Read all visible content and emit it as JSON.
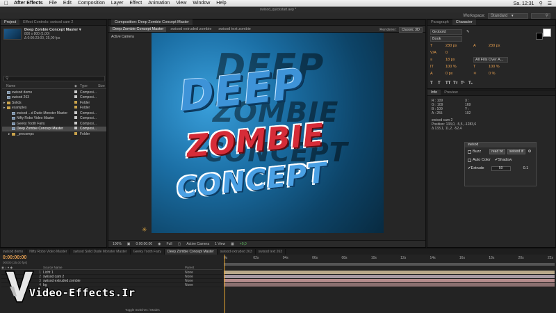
{
  "menubar": {
    "app_name": "After Effects",
    "items": [
      "File",
      "Edit",
      "Composition",
      "Layer",
      "Effect",
      "Animation",
      "View",
      "Window",
      "Help"
    ],
    "clock": "Sa. 12:31"
  },
  "window": {
    "title": "swisod_quickstart.aep *"
  },
  "workspace": {
    "label": "Workspace:",
    "value": "Standard"
  },
  "project_panel": {
    "tabs": [
      "Project",
      "Effect Controls: swisod cam 2"
    ],
    "selected_name": "Deep Zombie Concept Master ▾",
    "selected_size": "800 x 800 (1,00)",
    "selected_duration": "Δ 0:00:23:00, 25,00 fps",
    "columns": {
      "name": "Name",
      "type": "Type",
      "size": "Size"
    },
    "items": [
      {
        "name": "swisod demo",
        "type": "Composi...",
        "kind": "comp",
        "indent": 0,
        "color": "#c9c9c9"
      },
      {
        "name": "swisod 263",
        "type": "Composi...",
        "kind": "comp",
        "indent": 0,
        "color": "#c9c9c9"
      },
      {
        "name": "Solids",
        "type": "Folder",
        "kind": "folder",
        "indent": 0,
        "color": "#c9a24b"
      },
      {
        "name": "examples",
        "type": "Folder",
        "kind": "folder",
        "indent": 0,
        "color": "#c9a24b"
      },
      {
        "name": "swisod ...d Dude Monster Master",
        "type": "Composi...",
        "kind": "comp",
        "indent": 1,
        "color": "#c9c9c9"
      },
      {
        "name": "Nifty Robo Video Master",
        "type": "Composi...",
        "kind": "comp",
        "indent": 1,
        "color": "#c9c9c9"
      },
      {
        "name": "Geeky Tooth Fairy",
        "type": "Composi...",
        "kind": "comp",
        "indent": 1,
        "color": "#c9c9c9"
      },
      {
        "name": "Deep Zombie Concept Master",
        "type": "Composi...",
        "kind": "comp",
        "indent": 1,
        "color": "#c9c9c9",
        "selected": true
      },
      {
        "name": "_precomps",
        "type": "Folder",
        "kind": "folder",
        "indent": 1,
        "color": "#c9a24b"
      }
    ]
  },
  "comp_panel": {
    "title_tab": "Composition: Deep Zombie Concept Master",
    "view_tabs": [
      "Deep Zombie Concept Master",
      "swisod extruded zombie",
      "swisod text zombie"
    ],
    "renderer_label": "Renderer:",
    "renderer_value": "Classic 3D",
    "active_camera": "Active Camera",
    "art_lines": [
      "DEEP",
      "ZOMBIE",
      "CONCEPT"
    ],
    "footer": {
      "zoom": "100%",
      "timecode": "0:00:00:00",
      "resolution": "Full",
      "camera": "Active Camera",
      "views": "1 View",
      "exposure": "+0,0"
    }
  },
  "character_panel": {
    "tabs": [
      "Paragraph",
      "Character"
    ],
    "font": "Grobold",
    "style": "Book",
    "size": "230 px",
    "leading": "230 px",
    "kerning": "0",
    "stroke": "18 px",
    "stroke_mode": "All Fills Over A...",
    "vscale": "100 %",
    "hscale": "100 %",
    "baseline": "0 px",
    "tsume": "0 %",
    "formatting": [
      "T",
      "T",
      "TT",
      "Tт",
      "T¹",
      "T₁"
    ]
  },
  "info_panel": {
    "tabs": [
      "Info",
      "Preview"
    ],
    "r": "R : 109",
    "g": "G : 109",
    "b": "B : 109",
    "a": "A : 255",
    "x": "X : 169",
    "y": "Y : 102",
    "cam_name": "swisod cam 2",
    "position": "Position: 133,0, -5,5, -1283,6",
    "delta": "Δ 133,1, 11,2, -52,4"
  },
  "script_panel": {
    "title": "swisod",
    "buzz": "Buzz",
    "read_btn": "read txt",
    "swisod_btn": "swisod it!",
    "auto_color": "Auto Color",
    "shadow": "Shadow",
    "extrude": "Extrude",
    "extrude_val": "50",
    "right_val": "0.1"
  },
  "timeline": {
    "tabs": [
      "swisod demo",
      "Nifty Robo Video Master",
      "swisod Solid Dude Monster Master",
      "Geeky Tooth Fairy",
      "Deep Zombie Concept Master",
      "swisod extruded 263",
      "swisod text 263"
    ],
    "active_tab": 4,
    "time": "0:00:00:00",
    "fps": "00000 (25,00 fps)",
    "columns": {
      "source": "Source Name",
      "parent": "Parent"
    },
    "layers": [
      {
        "num": "1",
        "name": "Licht 1",
        "parent": "None"
      },
      {
        "num": "2",
        "name": "swisod cam 2",
        "parent": "None"
      },
      {
        "num": "3",
        "name": "swisod extruded zombie",
        "parent": "None"
      },
      {
        "num": "4",
        "name": "bg",
        "parent": "None"
      }
    ],
    "ruler": [
      "0s",
      "02s",
      "04s",
      "06s",
      "08s",
      "10s",
      "12s",
      "14s",
      "16s",
      "18s",
      "20s",
      "22s"
    ],
    "footer": "Toggle Switches / Modes"
  },
  "watermark": {
    "text": "Video-Effects.Ir"
  }
}
